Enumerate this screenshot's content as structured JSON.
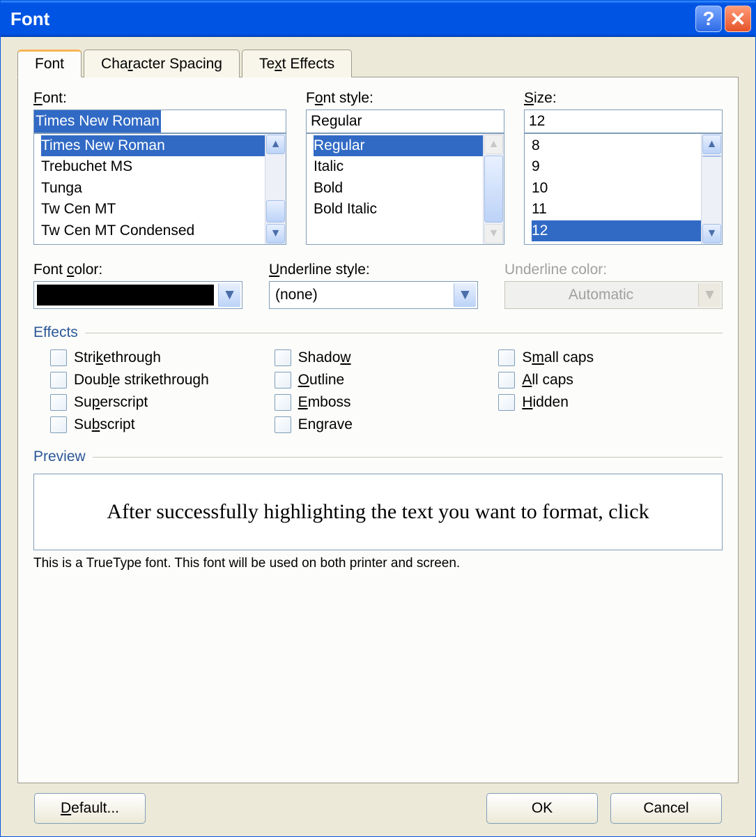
{
  "window": {
    "title": "Font"
  },
  "tabs": {
    "font": "Font",
    "spacing": "Character Spacing",
    "effects": "Text Effects"
  },
  "font_section": {
    "label": "Font:",
    "value": "Times New Roman",
    "items": [
      "Times New Roman",
      "Trebuchet MS",
      "Tunga",
      "Tw Cen MT",
      "Tw Cen MT Condensed"
    ]
  },
  "style_section": {
    "label": "Font style:",
    "value": "Regular",
    "items": [
      "Regular",
      "Italic",
      "Bold",
      "Bold Italic"
    ]
  },
  "size_section": {
    "label": "Size:",
    "value": "12",
    "items": [
      "8",
      "9",
      "10",
      "11",
      "12"
    ]
  },
  "color": {
    "label": "Font color:",
    "value": "#000000"
  },
  "underline_style": {
    "label": "Underline style:",
    "value": "(none)"
  },
  "underline_color": {
    "label": "Underline color:",
    "value": "Automatic"
  },
  "effects": {
    "label": "Effects",
    "col1": [
      "Strikethrough",
      "Double strikethrough",
      "Superscript",
      "Subscript"
    ],
    "col2": [
      "Shadow",
      "Outline",
      "Emboss",
      "Engrave"
    ],
    "col3": [
      "Small caps",
      "All caps",
      "Hidden"
    ]
  },
  "preview": {
    "label": "Preview",
    "text": "After successfully highlighting the text you want to format, click",
    "hint": "This is a TrueType font. This font will be used on both printer and screen."
  },
  "buttons": {
    "default": "Default...",
    "ok": "OK",
    "cancel": "Cancel"
  }
}
